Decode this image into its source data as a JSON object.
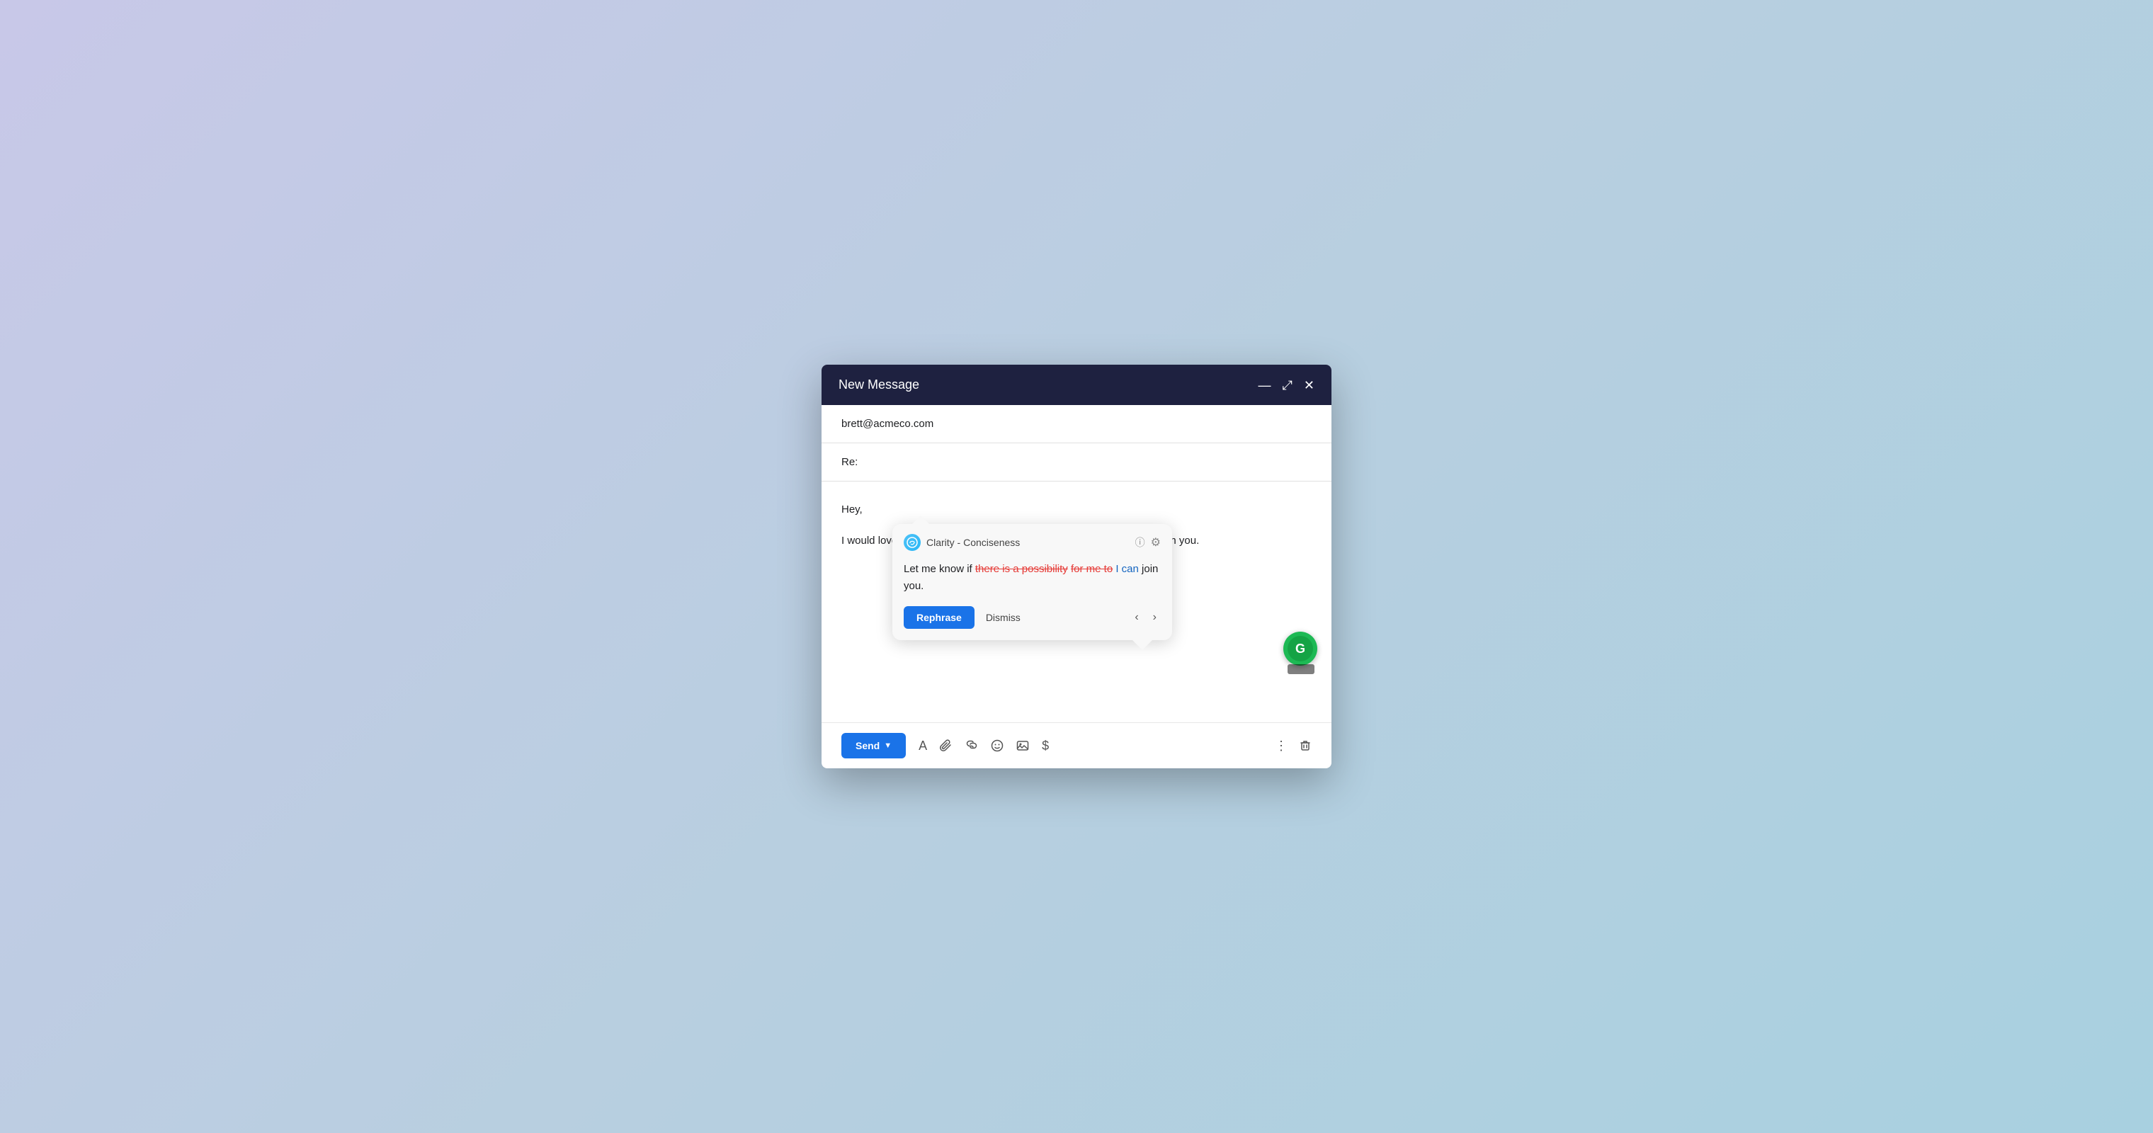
{
  "window": {
    "title": "New Message",
    "controls": {
      "minimize": "—",
      "maximize": "⤢",
      "close": "✕"
    }
  },
  "email": {
    "to": "brett@acmeco.com",
    "subject": "Re:",
    "greeting": "Hey,",
    "body_before": "I would love to attend. Let me know if ",
    "highlighted": "there is a possibility for me to",
    "body_after": " join you."
  },
  "suggestion": {
    "category": "Clarity - Conciseness",
    "prefix": "Let me know if ",
    "strikethrough1": "there is a possibility",
    "strikethrough2": "for me to",
    "new_text": "I can",
    "suffix": " join you.",
    "rephrase_label": "Rephrase",
    "dismiss_label": "Dismiss"
  },
  "toolbar": {
    "send_label": "Send",
    "icons": [
      "A",
      "📎",
      "🔗",
      "😊",
      "🖼",
      "$"
    ]
  }
}
